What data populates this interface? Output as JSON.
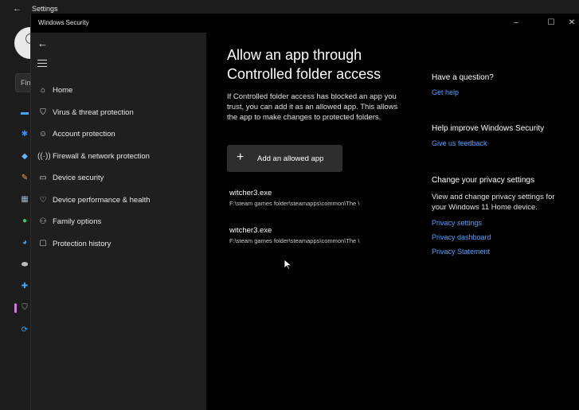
{
  "settings": {
    "title": "Settings",
    "find_placeholder": "Fin"
  },
  "window": {
    "title": "Windows Security",
    "minimize": "–",
    "maximize": "☐",
    "close": "✕"
  },
  "nav": {
    "items": [
      {
        "label": "Home",
        "icon": "home-icon"
      },
      {
        "label": "Virus & threat protection",
        "icon": "shield-icon"
      },
      {
        "label": "Account protection",
        "icon": "person-icon"
      },
      {
        "label": "Firewall & network protection",
        "icon": "wireless-icon"
      },
      {
        "label": "Device security",
        "icon": "laptop-icon"
      },
      {
        "label": "Device performance & health",
        "icon": "heart-icon"
      },
      {
        "label": "Family options",
        "icon": "family-icon"
      },
      {
        "label": "Protection history",
        "icon": "history-icon"
      }
    ]
  },
  "main": {
    "title_line1": "Allow an app through",
    "title_line2": "Controlled folder access",
    "description": "If Controlled folder access has blocked an app you trust, you can add it as an allowed app. This allows the app to make changes to protected folders.",
    "add_button": "Add an allowed app",
    "apps": [
      {
        "name": "witcher3.exe",
        "path": "F:\\steam games folder\\steamapps\\common\\The \\"
      },
      {
        "name": "witcher3.exe",
        "path": "F:\\steam games folder\\steamapps\\common\\The \\"
      }
    ]
  },
  "side": {
    "question_heading": "Have a question?",
    "get_help": "Get help",
    "improve_heading": "Help improve Windows Security",
    "feedback": "Give us feedback",
    "privacy_heading": "Change your privacy settings",
    "privacy_text": "View and change privacy settings for your Windows 11 Home device.",
    "privacy_settings": "Privacy settings",
    "privacy_dashboard": "Privacy dashboard",
    "privacy_statement": "Privacy Statement"
  },
  "colors": {
    "link": "#4da3ff",
    "background": "#000000",
    "nav_background": "#1f1f1f"
  }
}
